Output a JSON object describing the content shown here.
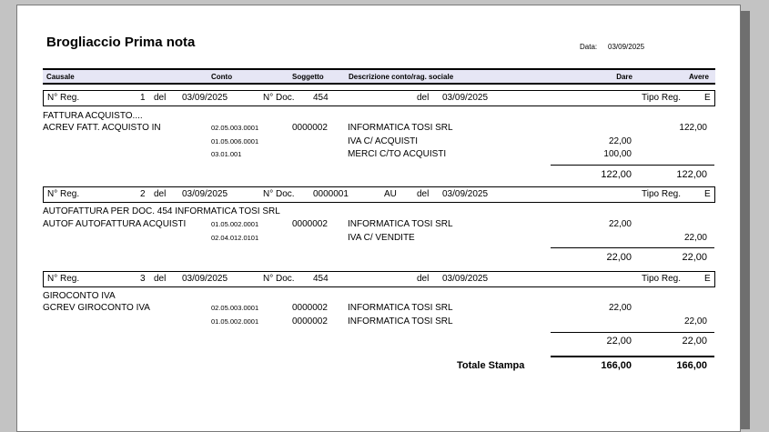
{
  "report": {
    "title": "Brogliaccio Prima nota",
    "date_label": "Data:",
    "date_value": "03/09/2025"
  },
  "columns": {
    "causale": "Causale",
    "conto": "Conto",
    "soggetto": "Soggetto",
    "descrizione": "Descrizione conto/rag. sociale",
    "dare": "Dare",
    "avere": "Avere"
  },
  "registrations": [
    {
      "reg_label": "N° Reg.",
      "reg_num": "1",
      "del1": "del",
      "reg_date": "03/09/2025",
      "doc_label": "N° Doc.",
      "doc_num": "454",
      "doc_suffix": "",
      "del2": "del",
      "doc_date": "03/09/2025",
      "tipo_label": "Tipo Reg.",
      "tipo": "E",
      "description": "FATTURA ACQUISTO....",
      "causale": "ACREV   FATT. ACQUISTO IN",
      "rows": [
        {
          "conto": "02.05.003.0001",
          "soggetto": "0000002",
          "descr": "INFORMATICA TOSI SRL",
          "dare": "",
          "avere": "122,00"
        },
        {
          "conto": "01.05.006.0001",
          "soggetto": "",
          "descr": "IVA C/ ACQUISTI",
          "dare": "22,00",
          "avere": ""
        },
        {
          "conto": "03.01.001",
          "soggetto": "",
          "descr": "MERCI C/TO ACQUISTI",
          "dare": "100,00",
          "avere": ""
        }
      ],
      "tot_dare": "122,00",
      "tot_avere": "122,00"
    },
    {
      "reg_label": "N° Reg.",
      "reg_num": "2",
      "del1": "del",
      "reg_date": "03/09/2025",
      "doc_label": "N° Doc.",
      "doc_num": "0000001",
      "doc_suffix": "AU",
      "del2": "del",
      "doc_date": "03/09/2025",
      "tipo_label": "Tipo Reg.",
      "tipo": "E",
      "description": "AUTOFATTURA PER DOC. 454 INFORMATICA TOSI SRL",
      "causale": "AUTOF   AUTOFATTURA ACQUISTI",
      "rows": [
        {
          "conto": "01.05.002.0001",
          "soggetto": "0000002",
          "descr": "INFORMATICA TOSI SRL",
          "dare": "22,00",
          "avere": ""
        },
        {
          "conto": "02.04.012.0101",
          "soggetto": "",
          "descr": "IVA C/ VENDITE",
          "dare": "",
          "avere": "22,00"
        }
      ],
      "tot_dare": "22,00",
      "tot_avere": "22,00"
    },
    {
      "reg_label": "N° Reg.",
      "reg_num": "3",
      "del1": "del",
      "reg_date": "03/09/2025",
      "doc_label": "N° Doc.",
      "doc_num": "454",
      "doc_suffix": "",
      "del2": "del",
      "doc_date": "03/09/2025",
      "tipo_label": "Tipo Reg.",
      "tipo": "E",
      "description": "GIROCONTO IVA",
      "causale": "GCREV   GIROCONTO IVA",
      "rows": [
        {
          "conto": "02.05.003.0001",
          "soggetto": "0000002",
          "descr": "INFORMATICA TOSI SRL",
          "dare": "22,00",
          "avere": ""
        },
        {
          "conto": "01.05.002.0001",
          "soggetto": "0000002",
          "descr": "INFORMATICA TOSI SRL",
          "dare": "",
          "avere": "22,00"
        }
      ],
      "tot_dare": "22,00",
      "tot_avere": "22,00"
    }
  ],
  "grand_total": {
    "label": "Totale Stampa",
    "dare": "166,00",
    "avere": "166,00"
  }
}
